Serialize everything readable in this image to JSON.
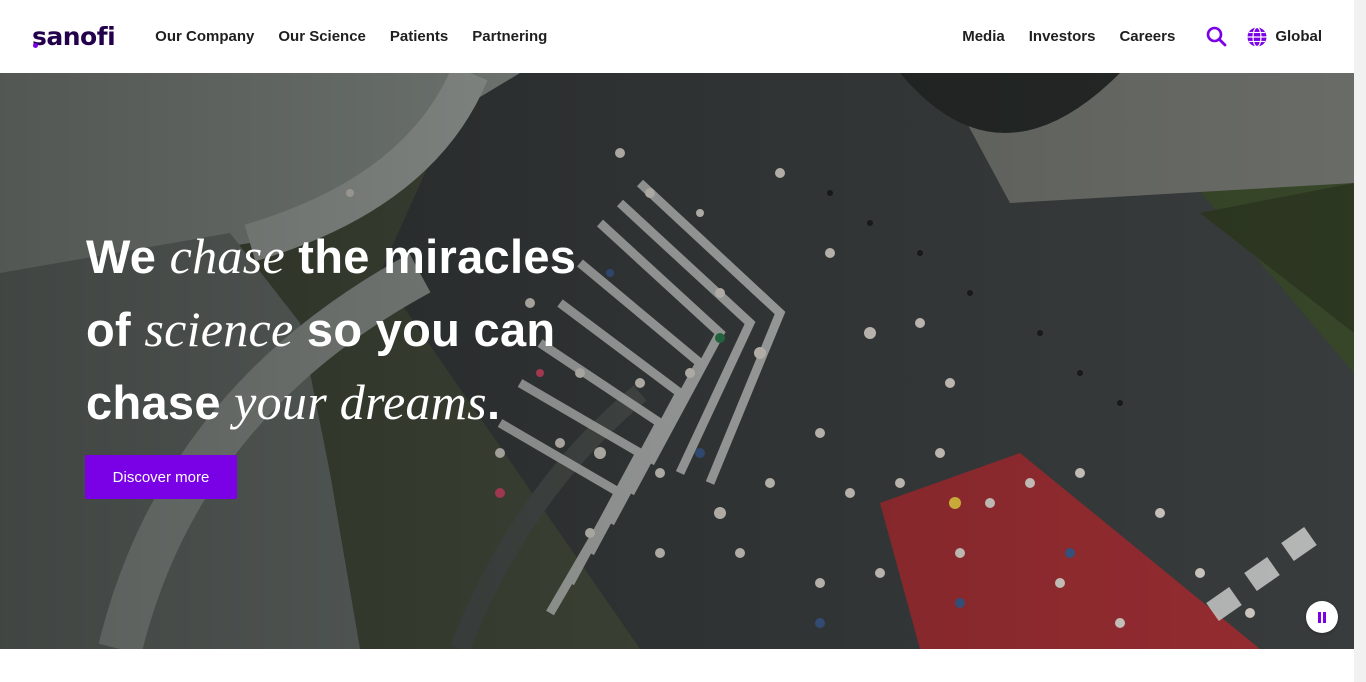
{
  "header": {
    "logo": "sanofi",
    "nav_left": [
      "Our Company",
      "Our Science",
      "Patients",
      "Partnering"
    ],
    "nav_right": [
      "Media",
      "Investors",
      "Careers"
    ],
    "search_icon": "search-icon",
    "region_icon": "globe-icon",
    "region_label": "Global"
  },
  "hero": {
    "headline": {
      "line1": {
        "a": "We ",
        "em": "chase",
        "b": " the miracles"
      },
      "line2": {
        "a": "of ",
        "em": "science",
        "b": " so you can"
      },
      "line3": {
        "a": "chase ",
        "em": "your dreams",
        "b": "."
      }
    },
    "cta_label": "Discover more",
    "pause_icon": "pause-icon",
    "background": "aerial-crowd-crosswalk-video"
  },
  "colors": {
    "brand": "#7a00e6",
    "logo_text": "#23004c",
    "nav_text": "#1f1f1f",
    "hero_text": "#ffffff"
  }
}
